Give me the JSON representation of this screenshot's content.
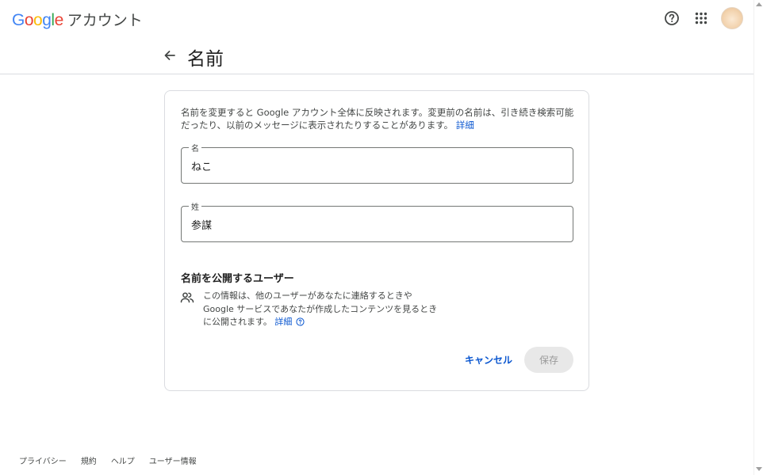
{
  "header": {
    "logo_letters": [
      "G",
      "o",
      "o",
      "g",
      "l",
      "e"
    ],
    "logo_product": "アカウント",
    "icons": [
      "help-icon",
      "apps-icon",
      "avatar"
    ]
  },
  "page": {
    "title": "名前",
    "back_icon": "arrow-left-icon"
  },
  "card": {
    "intro_text": "名前を変更すると Google アカウント全体に反映されます。変更前の名前は、引き続き検索可能だったり、以前のメッセージに表示されたりすることがあります。",
    "intro_link": "詳細",
    "first_name": {
      "label": "名",
      "value": "ねこ"
    },
    "last_name": {
      "label": "姓",
      "value": "参謀"
    },
    "visibility": {
      "title": "名前を公開するユーザー",
      "icon": "people-icon",
      "description": "この情報は、他のユーザーがあなたに連絡するときやGoogle サービスであなたが作成したコンテンツを見るときに公開されます。",
      "link": "詳細"
    },
    "cancel_label": "キャンセル",
    "save_label": "保存"
  },
  "footer": {
    "links": [
      "プライバシー",
      "規約",
      "ヘルプ",
      "ユーザー情報"
    ]
  },
  "colors": {
    "link_blue": "#0b57d0",
    "border": "#dadce0",
    "save_disabled_bg": "#e8e8e8"
  }
}
